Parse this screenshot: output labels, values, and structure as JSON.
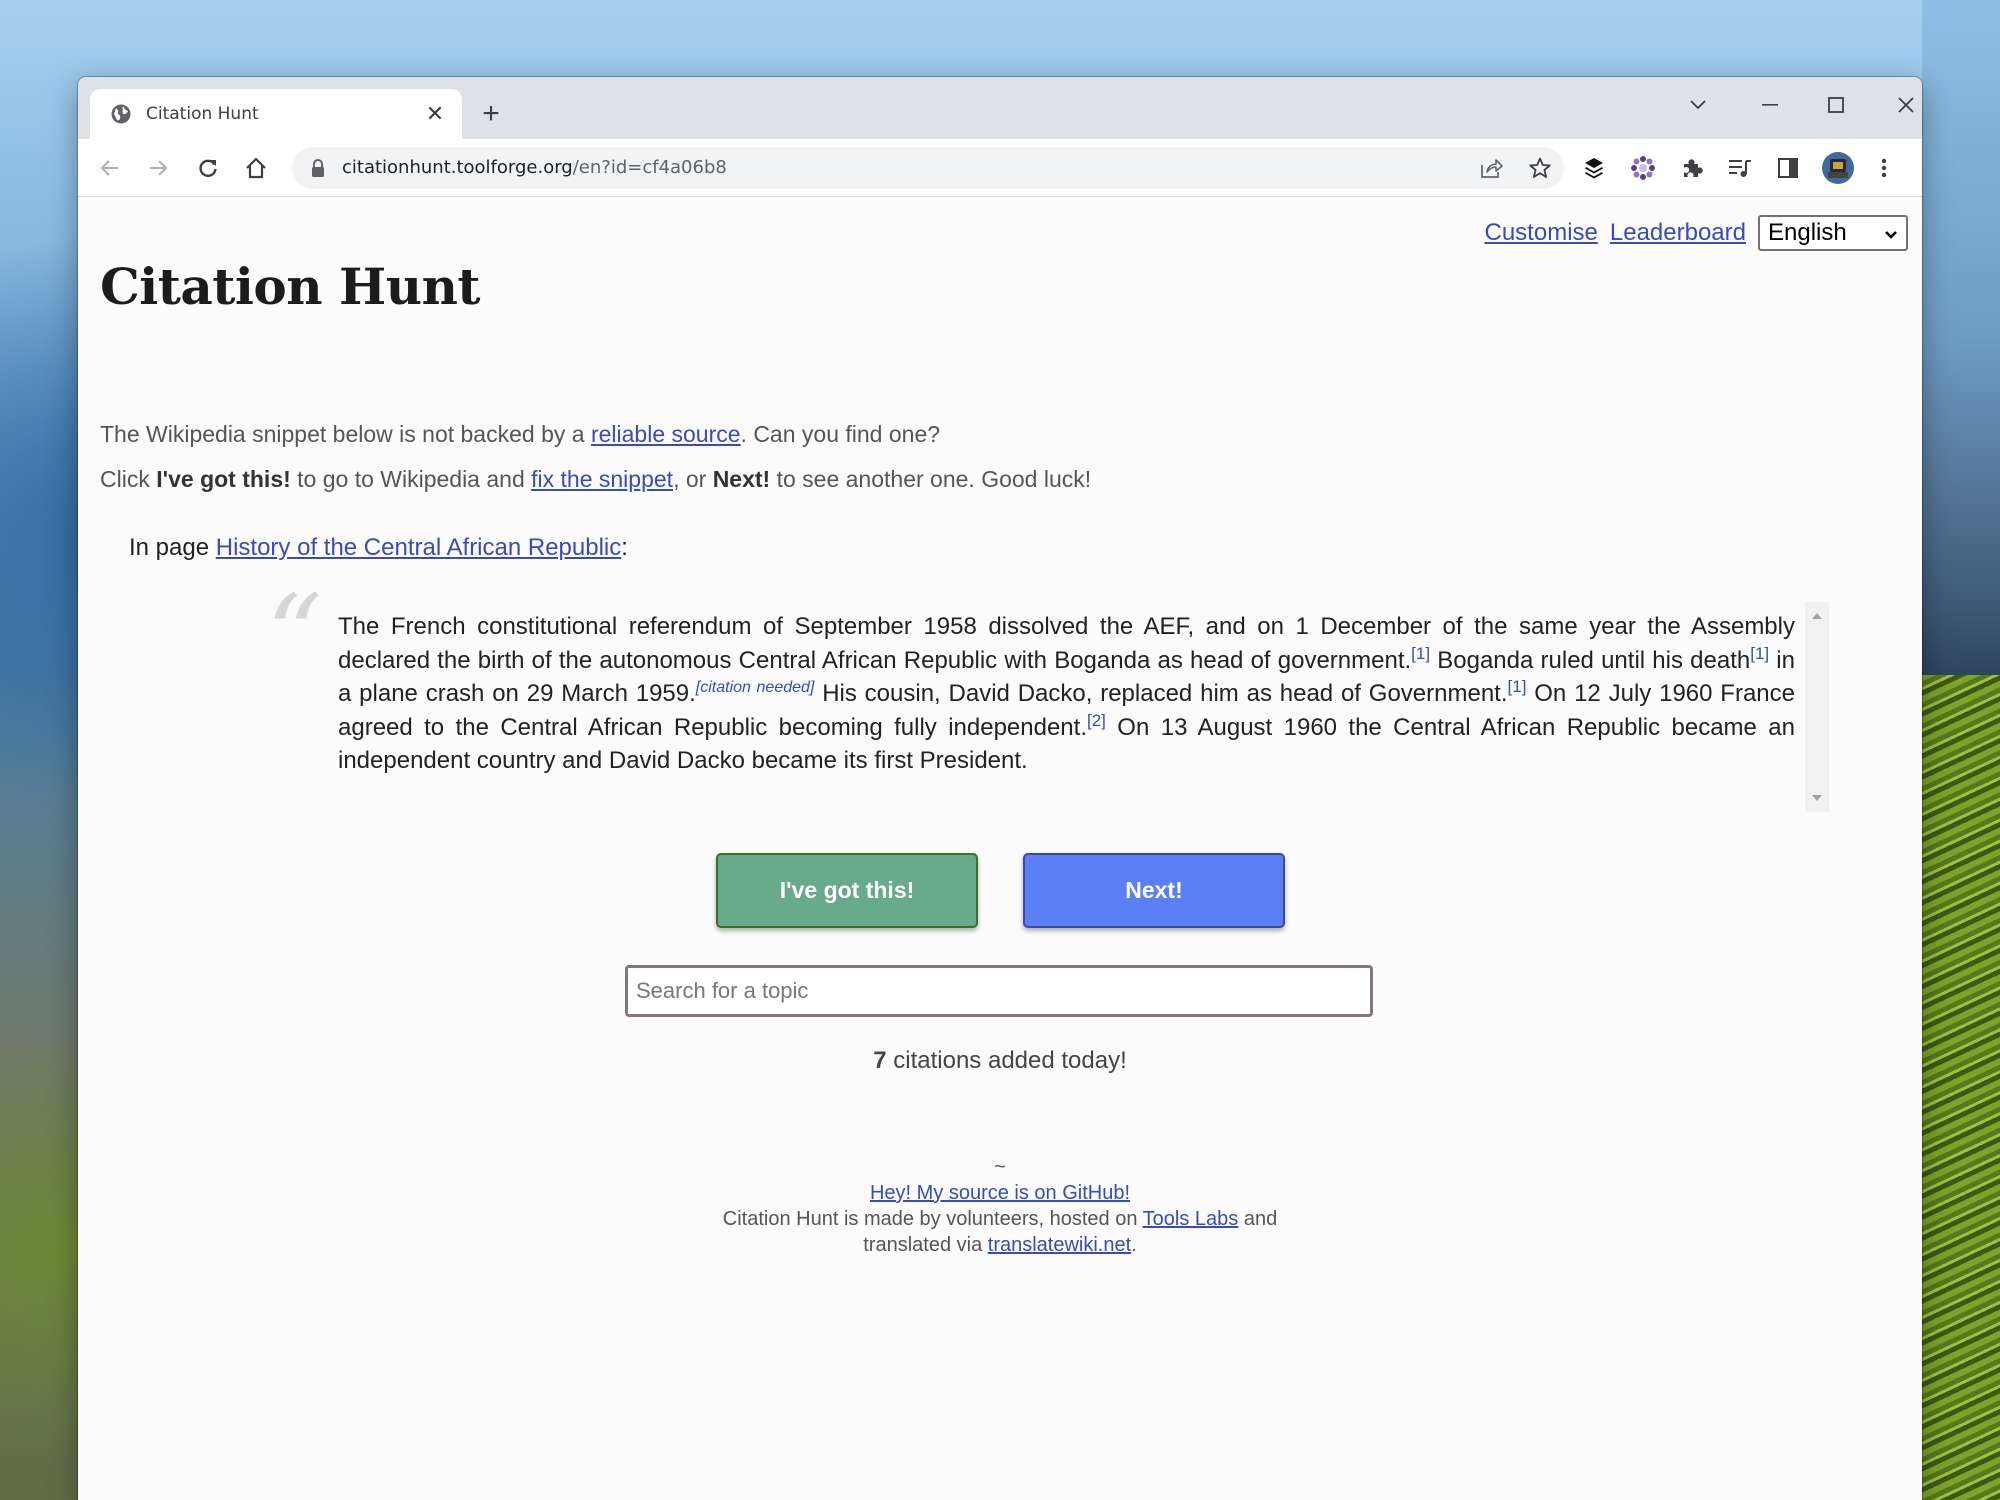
{
  "browser": {
    "tab": {
      "title": "Citation Hunt",
      "favicon": "globe-icon"
    },
    "new_tab_label": "+",
    "url": {
      "domain": "citationhunt.toolforge.org",
      "path": "/en?id=cf4a06b8"
    },
    "toolbar_icons": [
      "back-icon",
      "forward-icon",
      "reload-icon",
      "home-icon",
      "lock-icon",
      "share-icon",
      "star-icon",
      "layers-extension-icon",
      "flower-extension-icon",
      "puzzle-extensions-icon",
      "media-queue-icon",
      "side-panel-icon",
      "profile-avatar",
      "menu-kebab-icon"
    ],
    "window_controls": [
      "tab-search-icon",
      "minimize-icon",
      "maximize-icon",
      "close-icon"
    ]
  },
  "header": {
    "customise": "Customise",
    "leaderboard": "Leaderboard",
    "language": "English"
  },
  "title": "Citation Hunt",
  "intro": {
    "line1_a": "The Wikipedia snippet below is not backed by a ",
    "line1_link": "reliable source",
    "line1_b": ". Can you find one?",
    "line2_a": "Click ",
    "line2_bold1": "I've got this!",
    "line2_b": " to go to Wikipedia and ",
    "line2_link": "fix the snippet",
    "line2_c": ", or ",
    "line2_bold2": "Next!",
    "line2_d": " to see another one. Good luck!"
  },
  "in_page": {
    "prefix": "In page ",
    "article": "History of the Central African Republic",
    "suffix": ":"
  },
  "snippet": {
    "quote_mark": "“",
    "s1": "The French constitutional referendum of September 1958 dissolved the AEF, and on 1 December of the same year the Assembly declared the birth of the autonomous Central African Republic with Boganda as head of government.",
    "ref1": "[1]",
    "s2": " Boganda ruled until his death",
    "ref2": "[1]",
    "s3": " in a plane crash on 29 March 1959.",
    "cn": "[citation needed]",
    "s4": " His cousin, David Dacko, replaced him as head of Government.",
    "ref3": "[1]",
    "s5": " On 12 July 1960 France agreed to the Central African Republic becoming fully independent.",
    "ref4": "[2]",
    "s6": " On 13 August 1960 the Central African Republic became an independent country and David Dacko became its first President."
  },
  "actions": {
    "got_this": "I've got this!",
    "next": "Next!"
  },
  "search": {
    "placeholder": "Search for a topic",
    "value": ""
  },
  "stats": {
    "count": "7",
    "label": " citations added today!"
  },
  "footer": {
    "tilde": "~",
    "github": "Hey! My source is on GitHub!",
    "made_by_a": "Citation Hunt is made by volunteers, hosted on ",
    "tools_labs": "Tools Labs",
    "made_by_b": " and",
    "translated_a": "translated via ",
    "translatewiki": "translatewiki.net",
    "translated_b": "."
  },
  "colors": {
    "link": "#3a4bb5",
    "got_this_bg": "#68ab8a",
    "next_bg": "#5b7ff5"
  }
}
